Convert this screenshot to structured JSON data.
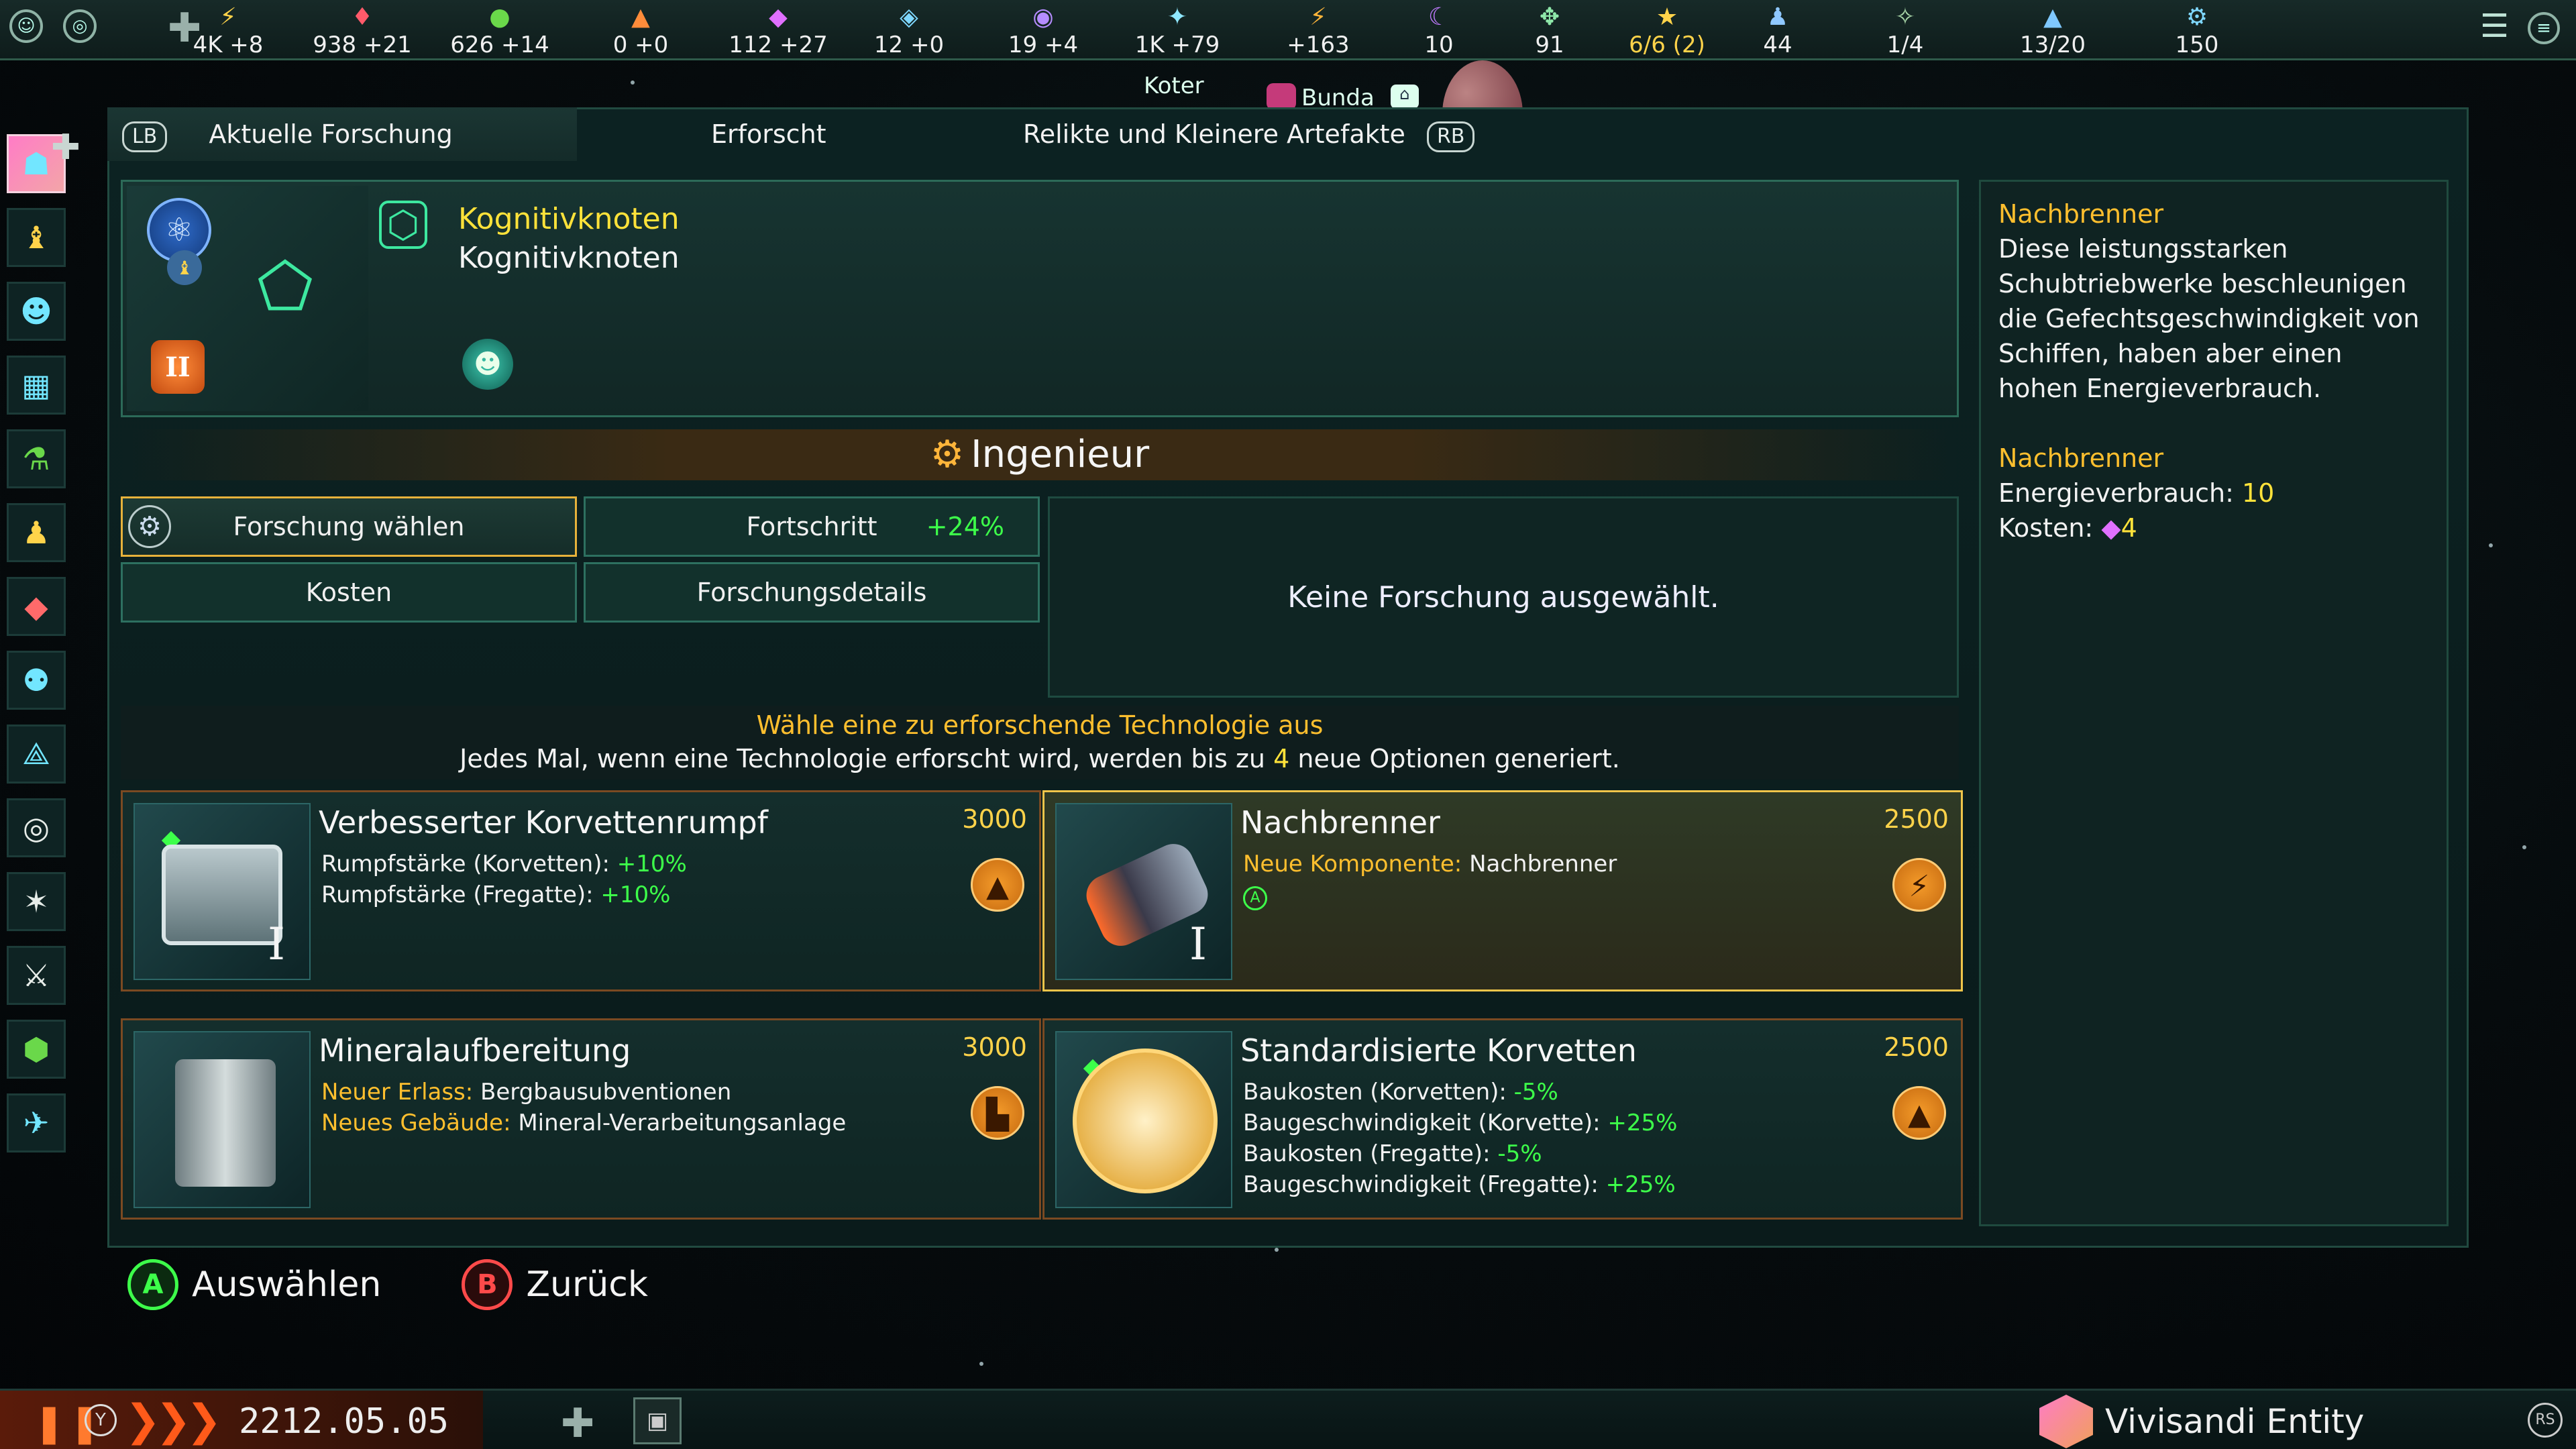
{
  "topbar": {
    "resources": [
      {
        "icon": "energy-icon",
        "glyph": "⚡",
        "value": "4K +8",
        "color": "#ffd34a"
      },
      {
        "icon": "minerals-icon",
        "glyph": "♦",
        "value": "938 +21",
        "color": "#ff5a6a"
      },
      {
        "icon": "food-icon",
        "glyph": "●",
        "value": "626 +14",
        "color": "#6ad84a"
      },
      {
        "icon": "consumer-goods-icon",
        "glyph": "▲",
        "value": "0 +0",
        "color": "#ff8c3a"
      },
      {
        "icon": "alloys-icon",
        "glyph": "◆",
        "value": "112 +27",
        "color": "#e070ff"
      },
      {
        "icon": "trade-icon",
        "glyph": "◈",
        "value": "12 +0",
        "color": "#7fd8ff"
      },
      {
        "icon": "influence-icon",
        "glyph": "◉",
        "value": "19 +4",
        "color": "#b58cff"
      },
      {
        "icon": "unity-icon",
        "glyph": "✦",
        "value": "1K +79",
        "color": "#8fe8ff"
      },
      {
        "icon": "research-icon",
        "glyph": "⚡",
        "value": "+163",
        "color": "#ffb53a"
      },
      {
        "icon": "amenities-icon",
        "glyph": "☾",
        "value": "10",
        "color": "#c07aff"
      },
      {
        "icon": "stability-icon",
        "glyph": "✥",
        "value": "91",
        "color": "#8fe8aa"
      },
      {
        "icon": "envoys-icon",
        "glyph": "★",
        "value": "6/6 (2)",
        "color": "#ffd34a"
      },
      {
        "icon": "population-icon",
        "glyph": "♟",
        "value": "44",
        "color": "#8fc8ff"
      },
      {
        "icon": "leaders-icon",
        "glyph": "✧",
        "value": "1/4",
        "color": "#aad8aa"
      },
      {
        "icon": "fleet-icon",
        "glyph": "▲",
        "value": "13/20",
        "color": "#7fc8ff"
      },
      {
        "icon": "naval-capacity-icon",
        "glyph": "⚙",
        "value": "150",
        "color": "#7fd8ff"
      }
    ]
  },
  "map_labels": {
    "koter": "Koter",
    "bunda": "Bunda"
  },
  "tabs": {
    "lb": "LB",
    "current": "Aktuelle Forschung",
    "researched": "Erforscht",
    "relics": "Relikte und Kleinere Artefakte",
    "rb": "RB"
  },
  "current_research": {
    "name_yellow": "Kognitivknoten",
    "name_white": "Kognitivknoten",
    "tier_badge": "II"
  },
  "banner": {
    "title": "Ingenieur"
  },
  "buttons": {
    "choose": "Forschung wählen",
    "progress": "Fortschritt",
    "progress_pct": "+24%",
    "costs": "Kosten",
    "details": "Forschungsdetails"
  },
  "detail_empty": "Keine Forschung ausgewählt.",
  "hint": {
    "line1": "Wähle eine zu erforschende Technologie aus",
    "line2_pre": "Jedes Mal, wenn eine Technologie erforscht wird, werden bis zu ",
    "line2_num": "4",
    "line2_post": " neue Optionen generiert."
  },
  "cards": [
    {
      "title": "Verbesserter Korvettenrumpf",
      "cost": "3000",
      "tier": "I",
      "l1_label": "Rumpfstärke (Korvetten): ",
      "l1_val": "+10%",
      "l2_label": "Rumpfstärke (Fregatte): ",
      "l2_val": "+10%"
    },
    {
      "title": "Nachbrenner",
      "cost": "2500",
      "tier": "I",
      "l1_label": "Neue Komponente: ",
      "l1_val": "Nachbrenner",
      "badge": "A"
    },
    {
      "title": "Mineralaufbereitung",
      "cost": "3000",
      "l1_label": "Neuer Erlass: ",
      "l1_val": "Bergbausubventionen",
      "l2_label": "Neues Gebäude: ",
      "l2_val": "Mineral-Verarbeitungsanlage"
    },
    {
      "title": "Standardisierte Korvetten",
      "cost": "2500",
      "l1_label": "Baukosten (Korvetten): ",
      "l1_val": "-5%",
      "l2_label": "Baugeschwindigkeit (Korvette): ",
      "l2_val": "+25%",
      "l3_label": "Baukosten (Fregatte): ",
      "l3_val": "-5%",
      "l4_label": "Baugeschwindigkeit (Fregatte): ",
      "l4_val": "+25%"
    }
  ],
  "sidepanel": {
    "h1": "Nachbrenner",
    "desc": "Diese leistungsstarken Schubtriebwerke beschleunigen die Gefechtsgeschwindigkeit von Schiffen, haben aber einen hohen Energieverbrauch.",
    "h2": "Nachbrenner",
    "energy_label": "Energieverbrauch: ",
    "energy_val": "10",
    "cost_label": "Kosten: ",
    "cost_val": "4"
  },
  "actions": {
    "a_key": "A",
    "a_label": "Auswählen",
    "b_key": "B",
    "b_label": "Zurück"
  },
  "bottombar": {
    "y_key": "Y",
    "date": "2212.05.05",
    "empire": "Vivisandi Entity",
    "rs": "RS"
  },
  "colors": {
    "accent_yellow": "#ffd34a",
    "positive": "#3dff4a",
    "orange": "#ffbf2e",
    "frame": "#2c6a58"
  }
}
